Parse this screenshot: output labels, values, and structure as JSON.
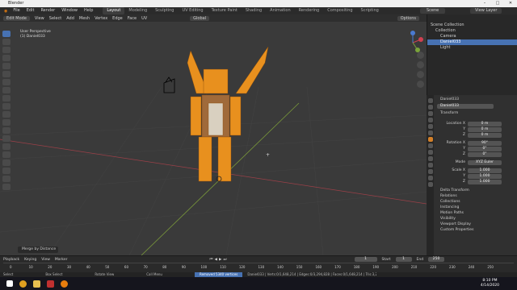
{
  "window": {
    "title": "Blender",
    "min": "–",
    "max": "□",
    "close": "✕"
  },
  "menus": [
    "File",
    "Edit",
    "Render",
    "Window",
    "Help"
  ],
  "workspaces": [
    "Layout",
    "Modeling",
    "Sculpting",
    "UV Editing",
    "Texture Paint",
    "Shading",
    "Animation",
    "Rendering",
    "Compositing",
    "Scripting"
  ],
  "active_workspace": "Layout",
  "scene": {
    "label": "Scene",
    "view_layer": "View Layer"
  },
  "viewport": {
    "mode": "Edit Mode",
    "menus": [
      "View",
      "Select",
      "Add",
      "Mesh",
      "Vertex",
      "Edge",
      "Face",
      "UV"
    ],
    "orientation": "Global",
    "options_label": "Options",
    "perspective_label": "User Perspective",
    "object_label": "(1) Daniel033",
    "last_op": "Merge by Distance"
  },
  "outliner": {
    "rows": [
      {
        "label": "Scene Collection",
        "indent": 0,
        "sel": false
      },
      {
        "label": "Collection",
        "indent": 1,
        "sel": false
      },
      {
        "label": "Camera",
        "indent": 2,
        "sel": false
      },
      {
        "label": "Daniel033",
        "indent": 2,
        "sel": true
      },
      {
        "label": "Light",
        "indent": 2,
        "sel": false
      }
    ]
  },
  "properties": {
    "object_name": "Daniel033",
    "object_name2": "Daniel033",
    "transform_label": "Transform",
    "location": {
      "label": "Location X",
      "x": "0 m",
      "y": "0 m",
      "z": "0 m"
    },
    "rotation": {
      "label": "Rotation X",
      "x": "90°",
      "y": "0°",
      "z": "0°"
    },
    "mode": {
      "label": "Mode",
      "value": "XYZ Euler"
    },
    "scale": {
      "label": "Scale X",
      "x": "1.000",
      "y": "1.000",
      "z": "1.000"
    },
    "axis_y": "Y",
    "axis_z": "Z",
    "panels": [
      "Delta Transform",
      "Relations",
      "Collections",
      "Instancing",
      "Motion Paths",
      "Visibility",
      "Viewport Display",
      "Custom Properties"
    ]
  },
  "timeline": {
    "menus": [
      "Playback",
      "Keying",
      "View",
      "Marker"
    ],
    "current_frame": "1",
    "start_label": "Start",
    "start": "1",
    "end_label": "End",
    "end": "250",
    "ticks": [
      "0",
      "10",
      "20",
      "30",
      "40",
      "50",
      "60",
      "70",
      "80",
      "90",
      "100",
      "110",
      "120",
      "130",
      "140",
      "150",
      "160",
      "170",
      "180",
      "190",
      "200",
      "210",
      "220",
      "230",
      "240",
      "250"
    ]
  },
  "statusbar": {
    "items": [
      "Select",
      "Box Select",
      "Rotate View",
      "Call Menu"
    ],
    "message": "Removed 5340 vertices",
    "stats": "Daniel033 | Verts:0/1,648,214 | Edges:0/3,294,828 | Faces:0/1,648,214 | Tris:3,296,428 | Mem: 732.7 MiB | 2.82.7"
  },
  "clock": {
    "time": "8:10 PM",
    "date": "4/14/2020"
  },
  "colors": {
    "accent": "#4772b3",
    "object_orange": "#e8901e",
    "active_tab": "#d48028"
  }
}
